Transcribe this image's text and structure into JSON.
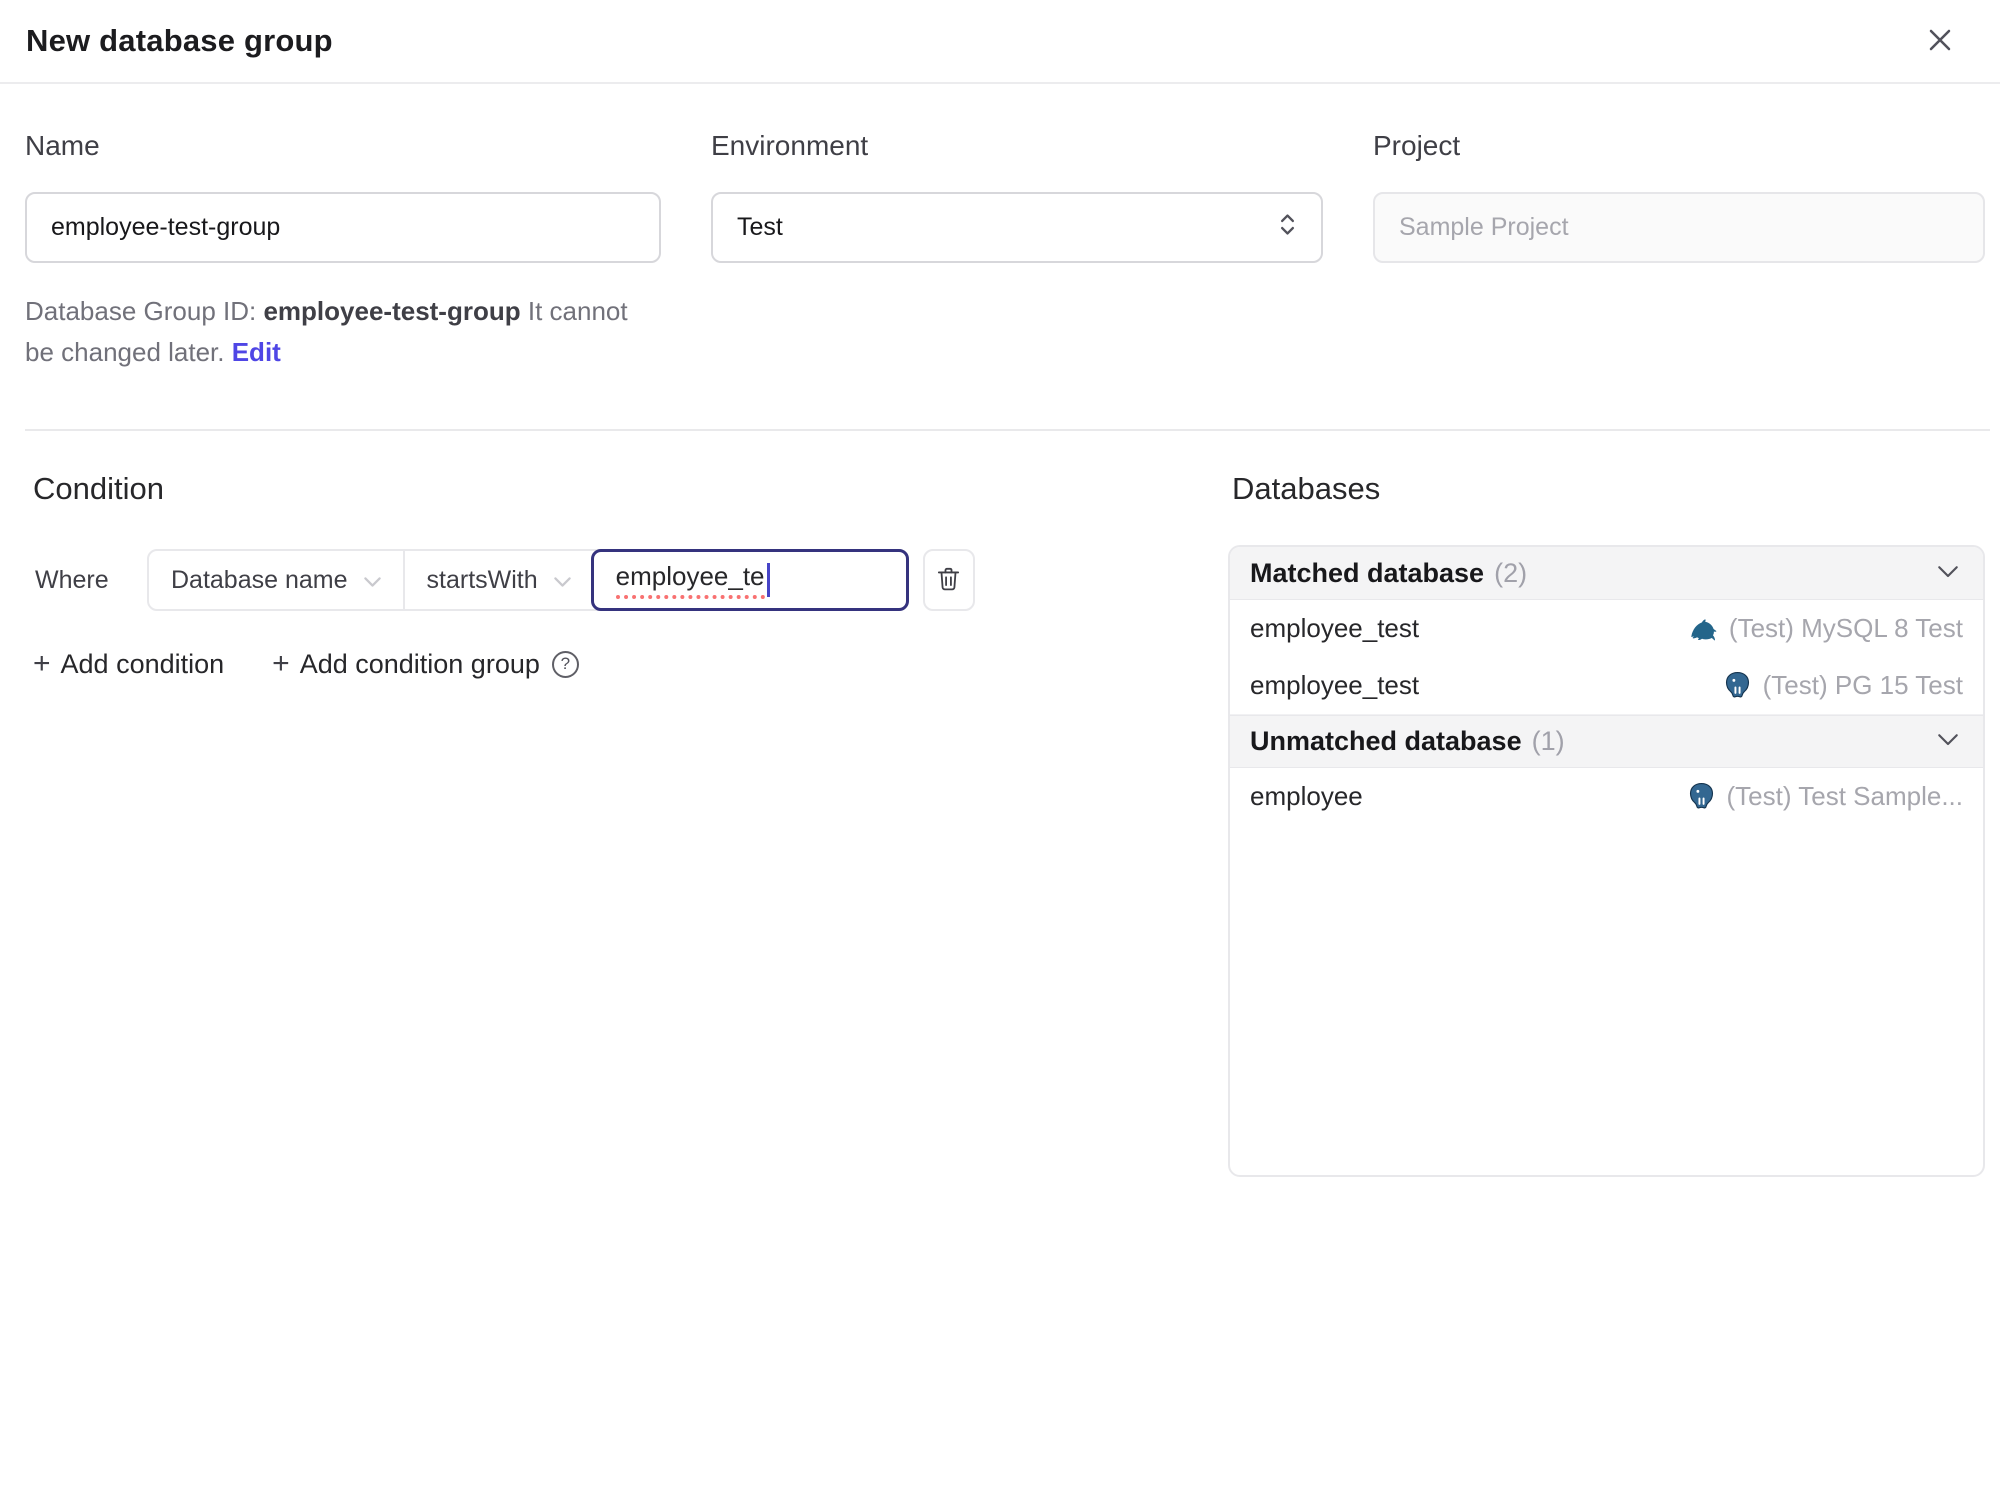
{
  "dialog": {
    "title": "New database group"
  },
  "icons": {
    "plus": "+",
    "help": "?"
  },
  "form": {
    "name": {
      "label": "Name",
      "value": "employee-test-group"
    },
    "environment": {
      "label": "Environment",
      "value": "Test"
    },
    "project": {
      "label": "Project",
      "value": "Sample Project"
    },
    "group_id_note": {
      "prefix": "Database Group ID: ",
      "id": "employee-test-group",
      "suffix": " It cannot be changed later. ",
      "edit_label": "Edit"
    }
  },
  "condition": {
    "heading": "Condition",
    "where_label": "Where",
    "factor": "Database name",
    "operator": "startsWith",
    "value": "employee_te",
    "add_condition_label": "Add condition",
    "add_condition_group_label": "Add condition group"
  },
  "databases": {
    "heading": "Databases",
    "matched": {
      "title": "Matched database",
      "count": "(2)",
      "rows": [
        {
          "name": "employee_test",
          "engine": "mysql",
          "instance": "(Test) MySQL 8 Test"
        },
        {
          "name": "employee_test",
          "engine": "postgres",
          "instance": "(Test) PG 15 Test"
        }
      ]
    },
    "unmatched": {
      "title": "Unmatched database",
      "count": "(1)",
      "rows": [
        {
          "name": "employee",
          "engine": "postgres",
          "instance": "(Test) Test Sample..."
        }
      ]
    }
  },
  "colors": {
    "accent_link": "#4f46e5",
    "focused_input_border": "#35337e",
    "spellcheck_underline": "#f87171",
    "mysql_icon": "#23658a",
    "postgres_icon": "#336791",
    "section_header_bg": "#f4f4f5"
  }
}
